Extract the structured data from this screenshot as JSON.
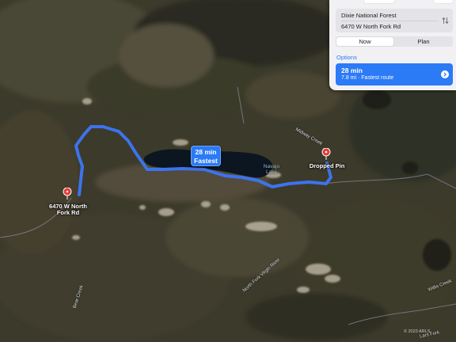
{
  "map": {
    "route_color": "#3d73ec",
    "pin_color": "#e53b38",
    "water_color": "#0c1620"
  },
  "origin": {
    "name": "6470 W North Fork Rd"
  },
  "destination": {
    "name": "Dropped Pin"
  },
  "route_badge": {
    "time": "28 min",
    "label": "Fastest"
  },
  "water_label": "Navajo Lake",
  "road_labels": [
    "Midway Creek",
    "Bear Creek",
    "North Fork Virgin River",
    "Willis Creek",
    "Lars Fork"
  ],
  "attribution": "© 2023 ARLS",
  "panel": {
    "from": "Dixie National Forest",
    "to": "6470 W North Fork Rd",
    "swap_icon": "swap-arrows-icon",
    "modes": [
      "Now",
      "Plan"
    ],
    "selected_mode": "Now",
    "options_label": "Options",
    "option": {
      "time": "28 min",
      "detail": "7.8 mi · Fastest route",
      "icon": "chevron-right-icon"
    }
  }
}
